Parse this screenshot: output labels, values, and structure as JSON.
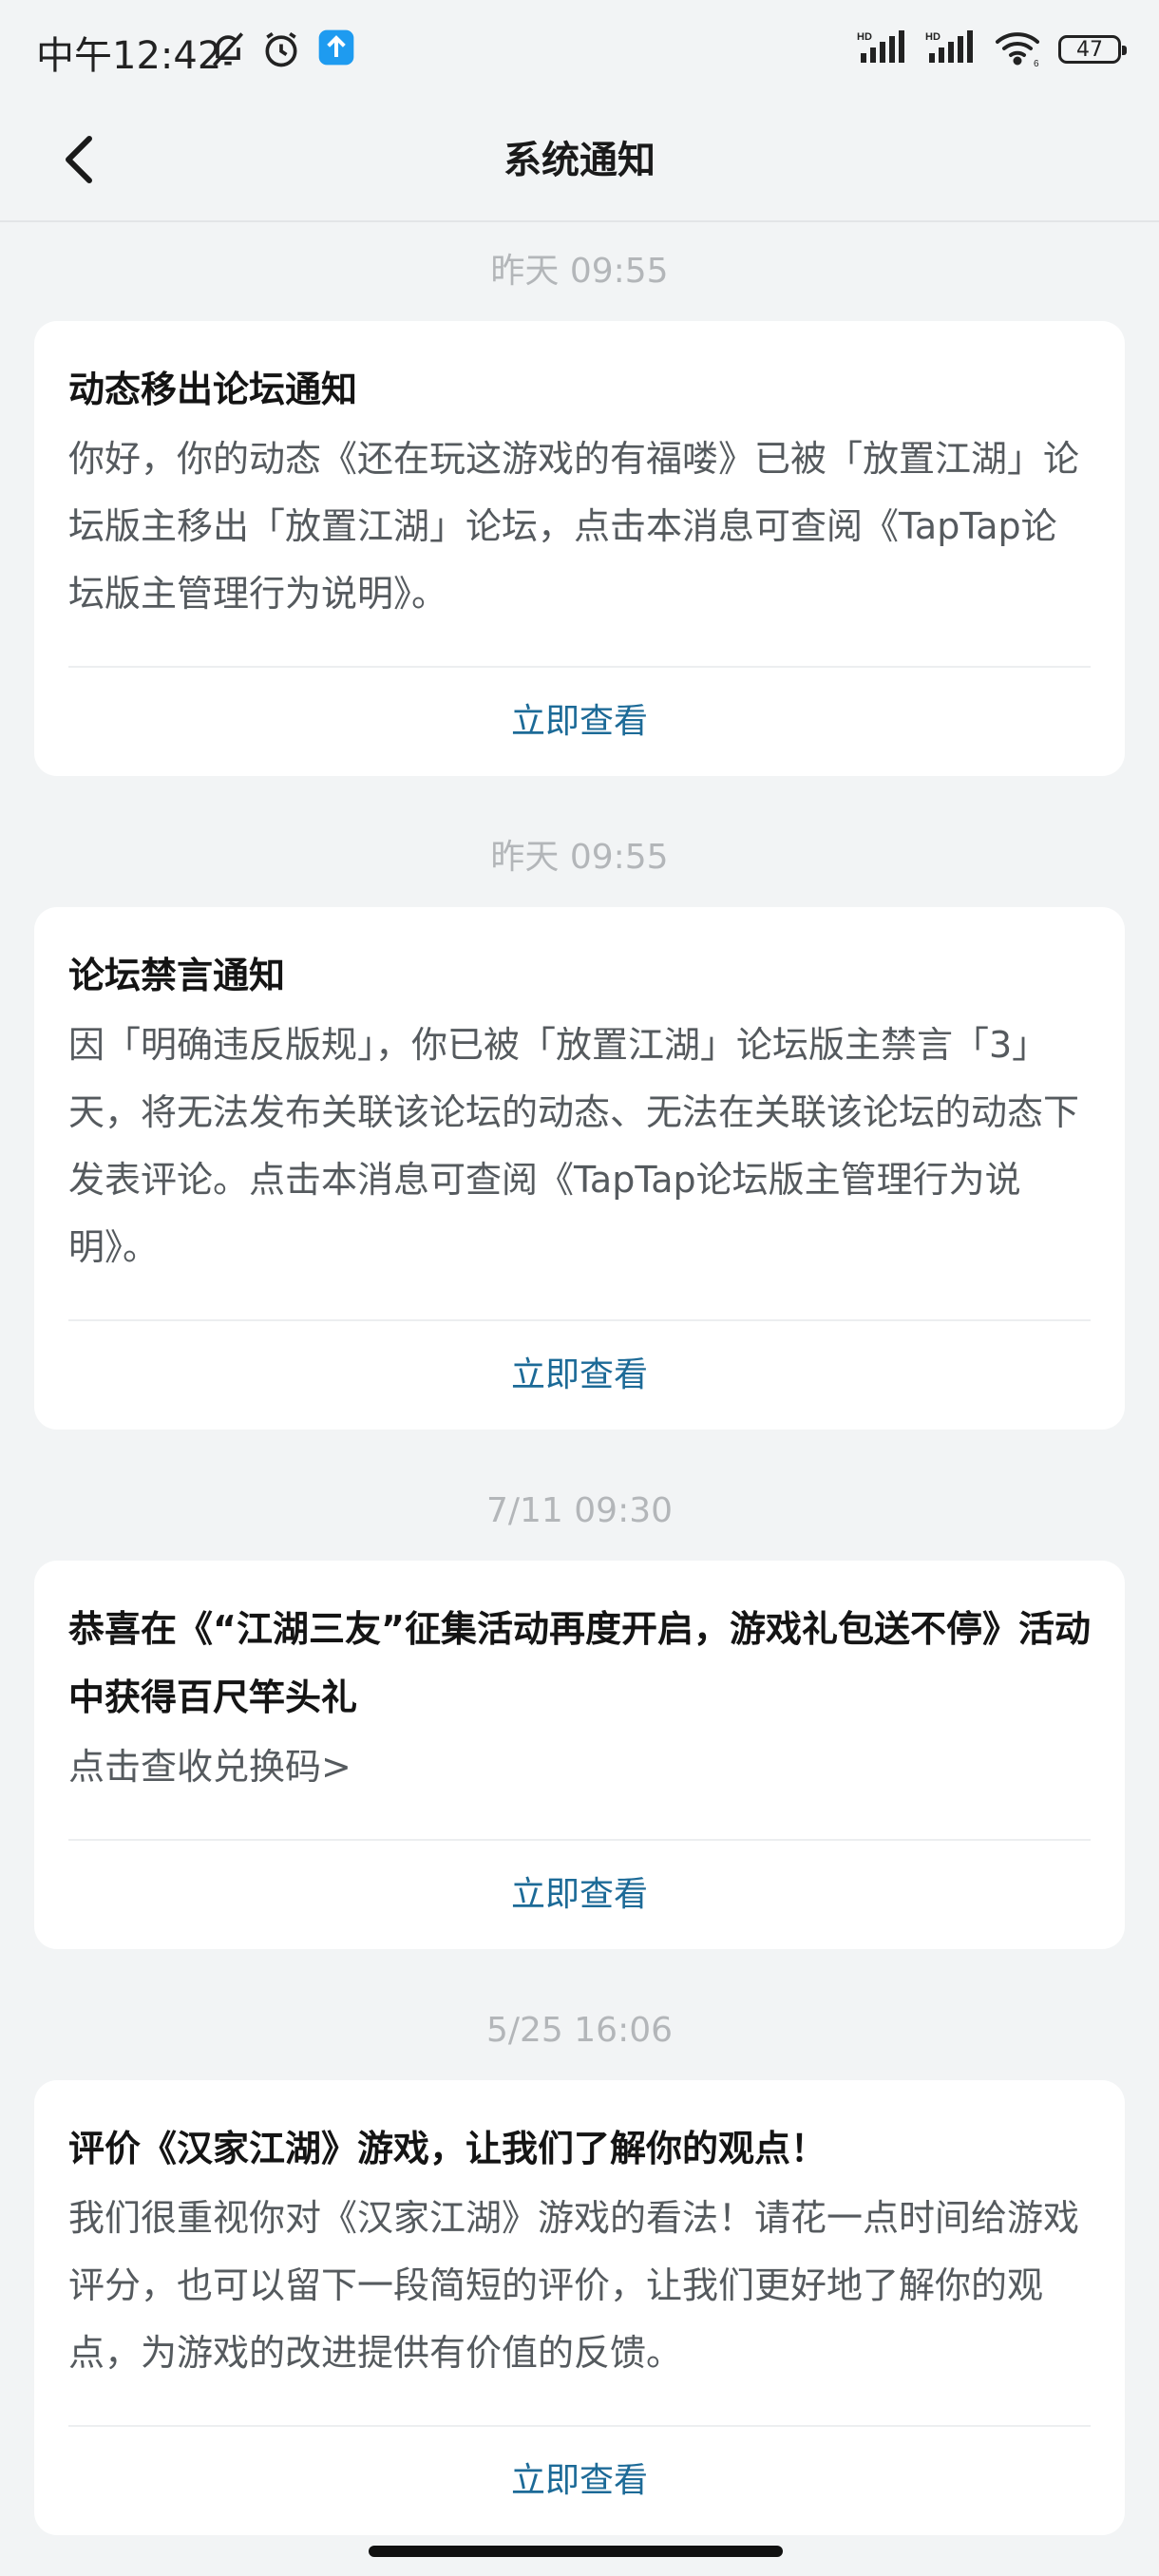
{
  "status_bar": {
    "time": "中午12:42",
    "battery": "47",
    "icons": [
      "bell-off-icon",
      "alarm-icon",
      "app-notification-icon",
      "hd-signal-icon",
      "hd-signal-icon",
      "wifi-icon",
      "battery-icon"
    ]
  },
  "header": {
    "title": "系统通知",
    "back_icon": "chevron-left-icon"
  },
  "notifications": [
    {
      "date": "昨天  09:55",
      "title": "动态移出论坛通知",
      "body": "你好，你的动态《还在玩这游戏的有福喽》已被「放置江湖」论坛版主移出「放置江湖」论坛，点击本消息可查阅《TapTap论坛版主管理行为说明》。",
      "action": "立即查看"
    },
    {
      "date": "昨天  09:55",
      "title": "论坛禁言通知",
      "body": "因「明确违反版规」，你已被「放置江湖」论坛版主禁言「3」天，将无法发布关联该论坛的动态、无法在关联该论坛的动态下发表评论。点击本消息可查阅《TapTap论坛版主管理行为说明》。",
      "action": "立即查看"
    },
    {
      "date": "7/11  09:30",
      "title": "恭喜在《“江湖三友”征集活动再度开启，游戏礼包送不停》活动中获得百尺竿头礼",
      "body": "点击查收兑换码>",
      "action": "立即查看"
    },
    {
      "date": "5/25  16:06",
      "title": "评价《汉家江湖》游戏，让我们了解你的观点！",
      "body": "我们很重视你对《汉家江湖》游戏的看法！请花一点时间给游戏评分，也可以留下一段简短的评价，让我们更好地了解你的观点，为游戏的改进提供有价值的反馈。",
      "action": "立即查看"
    }
  ],
  "colors": {
    "background": "#f2f4f5",
    "card": "#ffffff",
    "accent_link": "#1c6a97",
    "date_text": "#b3b6b9"
  }
}
